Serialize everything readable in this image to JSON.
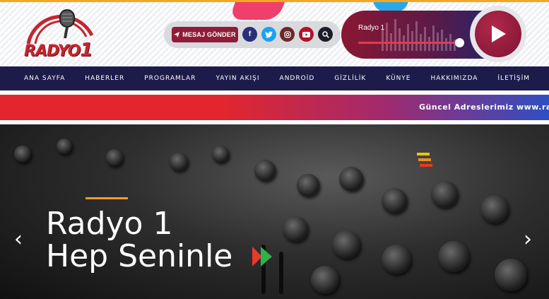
{
  "brand": {
    "logo_text": "RADYO 1"
  },
  "toolbar": {
    "message_button": "MESAJ GÖNDER",
    "social_icons": [
      "facebook-icon",
      "twitter-icon",
      "instagram-icon",
      "youtube-icon",
      "search-icon"
    ]
  },
  "player": {
    "station_name": "Radyo 1"
  },
  "nav": {
    "items": [
      "ANA SAYFA",
      "HABERLER",
      "PROGRAMLAR",
      "YAYIN AKIŞI",
      "ANDROİD",
      "GİZLİLİK",
      "KÜNYE",
      "HAKKIMIZDA",
      "İLETİŞİM"
    ]
  },
  "ticker": {
    "text": "Güncel Adreslerimiz www.rad"
  },
  "hero": {
    "line1": "Radyo 1",
    "line2": "Hep Seninle"
  },
  "colors": {
    "accent_orange": "#f5a623",
    "brand_red": "#c4262e",
    "nav_bg": "#1c1b4a",
    "message_button_bg": "#8e1d3a"
  }
}
